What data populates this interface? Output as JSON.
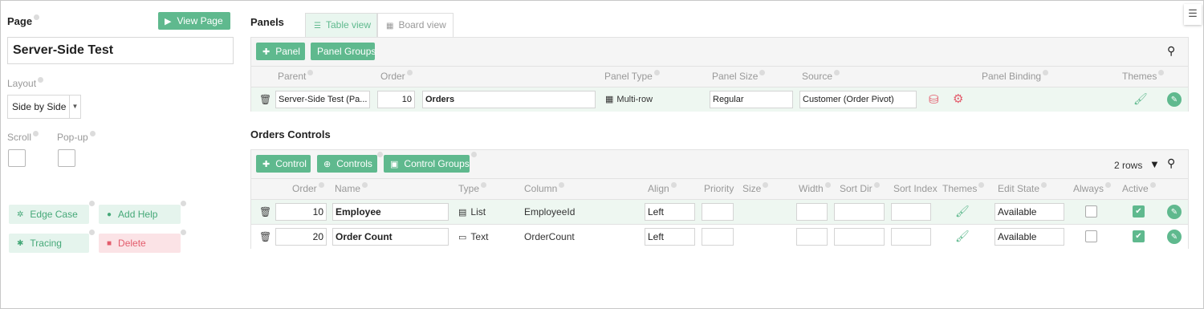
{
  "left": {
    "page_label": "Page",
    "view_page_btn": "View Page",
    "page_name": "Server-Side Test",
    "layout_label": "Layout",
    "layout_value": "Side by Side",
    "scroll_label": "Scroll",
    "popup_label": "Pop-up",
    "edge_case_btn": "Edge Case",
    "add_help_btn": "Add Help",
    "tracing_btn": "Tracing",
    "delete_btn": "Delete"
  },
  "panels": {
    "title": "Panels",
    "tab_table": "Table view",
    "tab_board": "Board view",
    "add_panel_btn": "Panel",
    "panel_groups_btn": "Panel Groups",
    "headers": {
      "parent": "Parent",
      "order": "Order",
      "panel_type": "Panel Type",
      "panel_size": "Panel Size",
      "source": "Source",
      "panel_binding": "Panel Binding",
      "themes": "Themes"
    },
    "row": {
      "parent": "Server-Side Test (Pa...",
      "order": "10",
      "name": "Orders",
      "panel_type": "Multi-row",
      "panel_size": "Regular",
      "source": "Customer (Order Pivot)"
    }
  },
  "controls": {
    "title": "Orders Controls",
    "add_control_btn": "Control",
    "controls_btn": "Controls",
    "control_groups_btn": "Control Groups",
    "row_count": "2 rows",
    "headers": {
      "order": "Order",
      "name": "Name",
      "type": "Type",
      "column": "Column",
      "align": "Align",
      "priority": "Priority",
      "size": "Size",
      "width": "Width",
      "sort_dir": "Sort Dir",
      "sort_index": "Sort Index",
      "themes": "Themes",
      "edit_state": "Edit State",
      "always": "Always",
      "active": "Active"
    },
    "rows": [
      {
        "order": "10",
        "name": "Employee",
        "type": "List",
        "column": "EmployeeId",
        "align": "Left",
        "edit_state": "Available",
        "always": false,
        "active": true
      },
      {
        "order": "20",
        "name": "Order Count",
        "type": "Text",
        "column": "OrderCount",
        "align": "Left",
        "edit_state": "Available",
        "always": false,
        "active": true
      }
    ]
  }
}
